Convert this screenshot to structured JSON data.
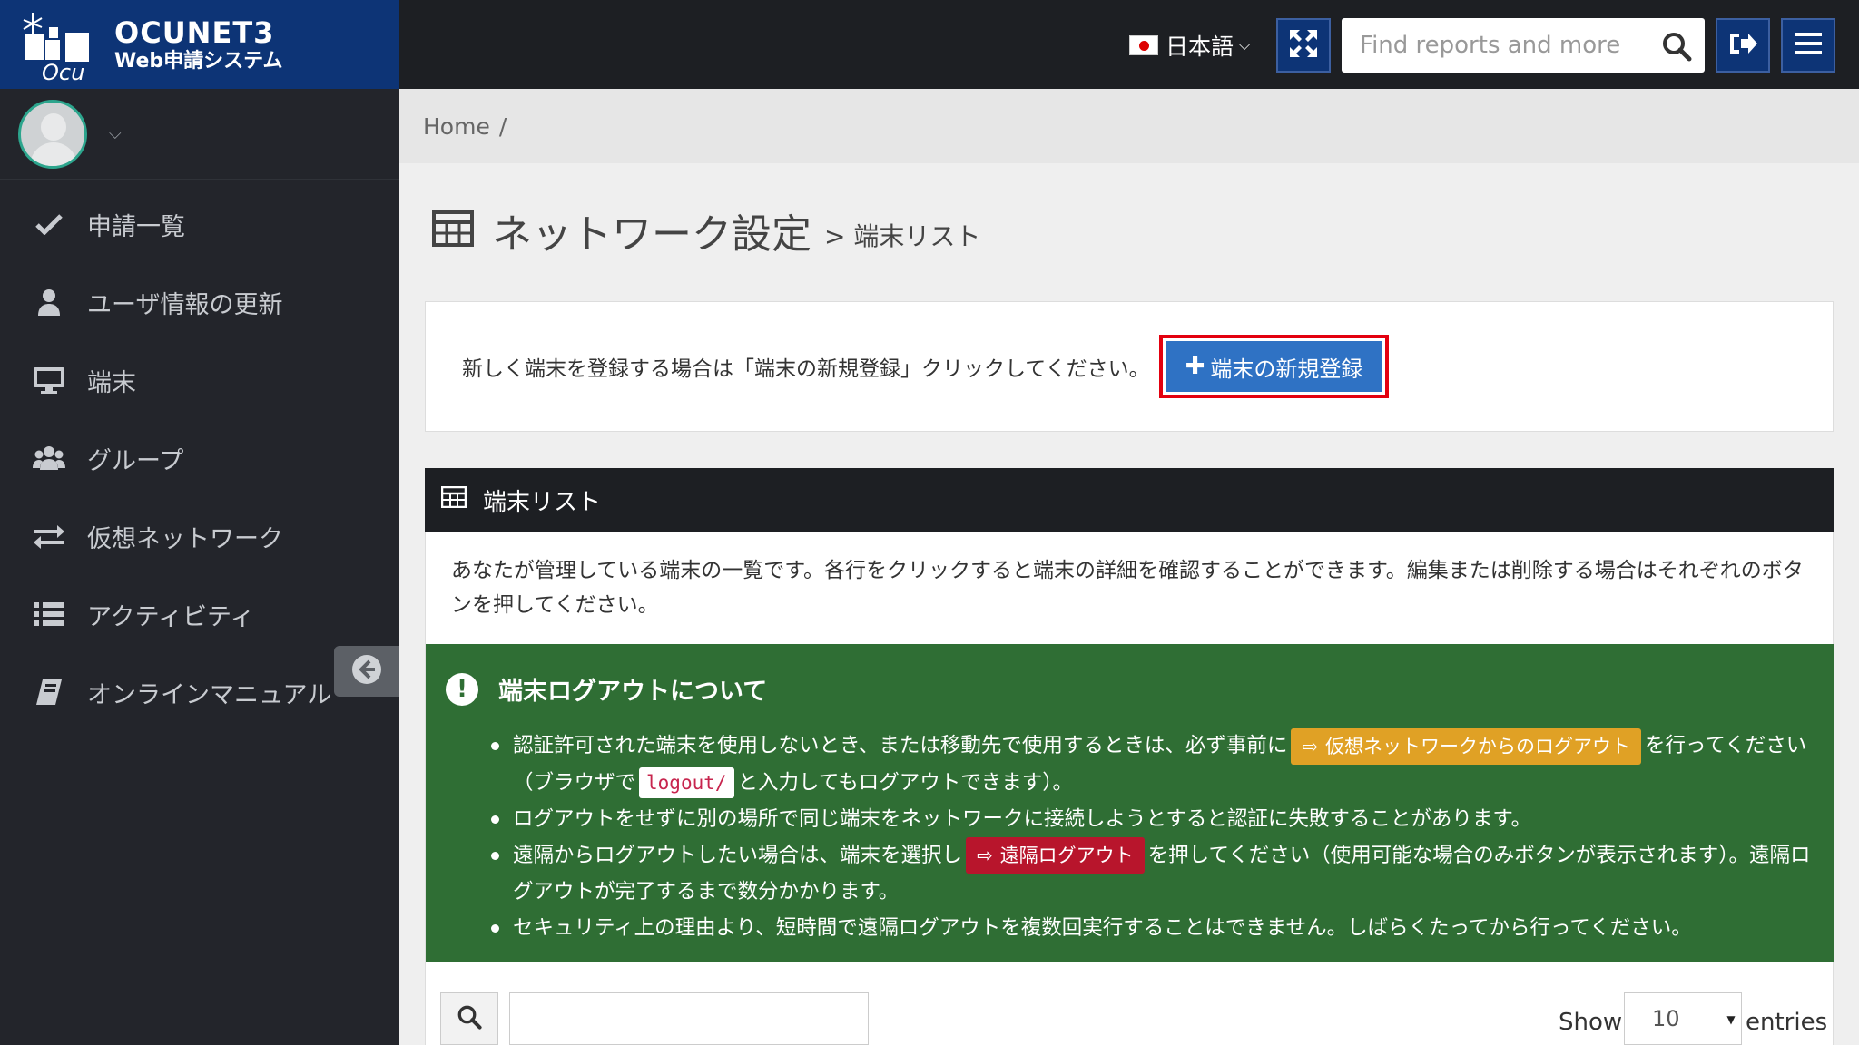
{
  "app": {
    "logo_title": "OCUNET3",
    "logo_subtitle": "Web申請システム"
  },
  "topbar": {
    "language": "日本語",
    "search_placeholder": "Find reports and more",
    "icons": [
      "fullscreen-icon",
      "search-icon",
      "logout-icon",
      "menu-icon"
    ]
  },
  "sidebar": {
    "items": [
      {
        "label": "申請一覧",
        "icon": "check-icon"
      },
      {
        "label": "ユーザ情報の更新",
        "icon": "user-icon"
      },
      {
        "label": "端末",
        "icon": "monitor-icon"
      },
      {
        "label": "グループ",
        "icon": "users-icon"
      },
      {
        "label": "仮想ネットワーク",
        "icon": "exchange-icon"
      },
      {
        "label": "アクティビティ",
        "icon": "list-icon"
      },
      {
        "label": "オンラインマニュアル",
        "icon": "book-icon"
      }
    ]
  },
  "breadcrumb": {
    "home": "Home",
    "separator": "/"
  },
  "page": {
    "title": "ネットワーク設定",
    "subtitle": "> 端末リスト"
  },
  "register_box": {
    "message": "新しく端末を登録する場合は「端末の新規登録」クリックしてください。",
    "button_label": "端末の新規登録"
  },
  "panel": {
    "title": "端末リスト",
    "description": "あなたが管理している端末の一覧です。各行をクリックすると端末の詳細を確認することができます。編集または削除する場合はそれぞれのボタンを押してください。"
  },
  "alert": {
    "title": "端末ログアウトについて",
    "item1_a": "認証許可された端末を使用しないとき、または移動先で使用するときは、必ず事前に",
    "item1_chip": "仮想ネットワークからのログアウト",
    "item1_b": "を行ってください（ブラウザで",
    "item1_code": "logout/",
    "item1_c": "と入力してもログアウトできます）。",
    "item2": "ログアウトをせずに別の場所で同じ端末をネットワークに接続しようとすると認証に失敗することがあります。",
    "item3_a": "遠隔からログアウトしたい場合は、端末を選択し",
    "item3_chip": "遠隔ログアウト",
    "item3_b": "を押してください（使用可能な場合のみボタンが表示されます）。遠隔ログアウトが完了するまで数分かかります。",
    "item4": "セキュリティ上の理由より、短時間で遠隔ログアウトを複数回実行することはできません。しばらくたってから行ってください。"
  },
  "table_tools": {
    "show_label": "Show",
    "show_value": "10",
    "entries_label": "entries"
  },
  "colors": {
    "brand": "#0d3476",
    "alert_green": "#2f6e34",
    "primary_button": "#2f72c4",
    "highlight": "#e3000f",
    "chip_orange": "#e0a125",
    "chip_red": "#b8152c"
  }
}
